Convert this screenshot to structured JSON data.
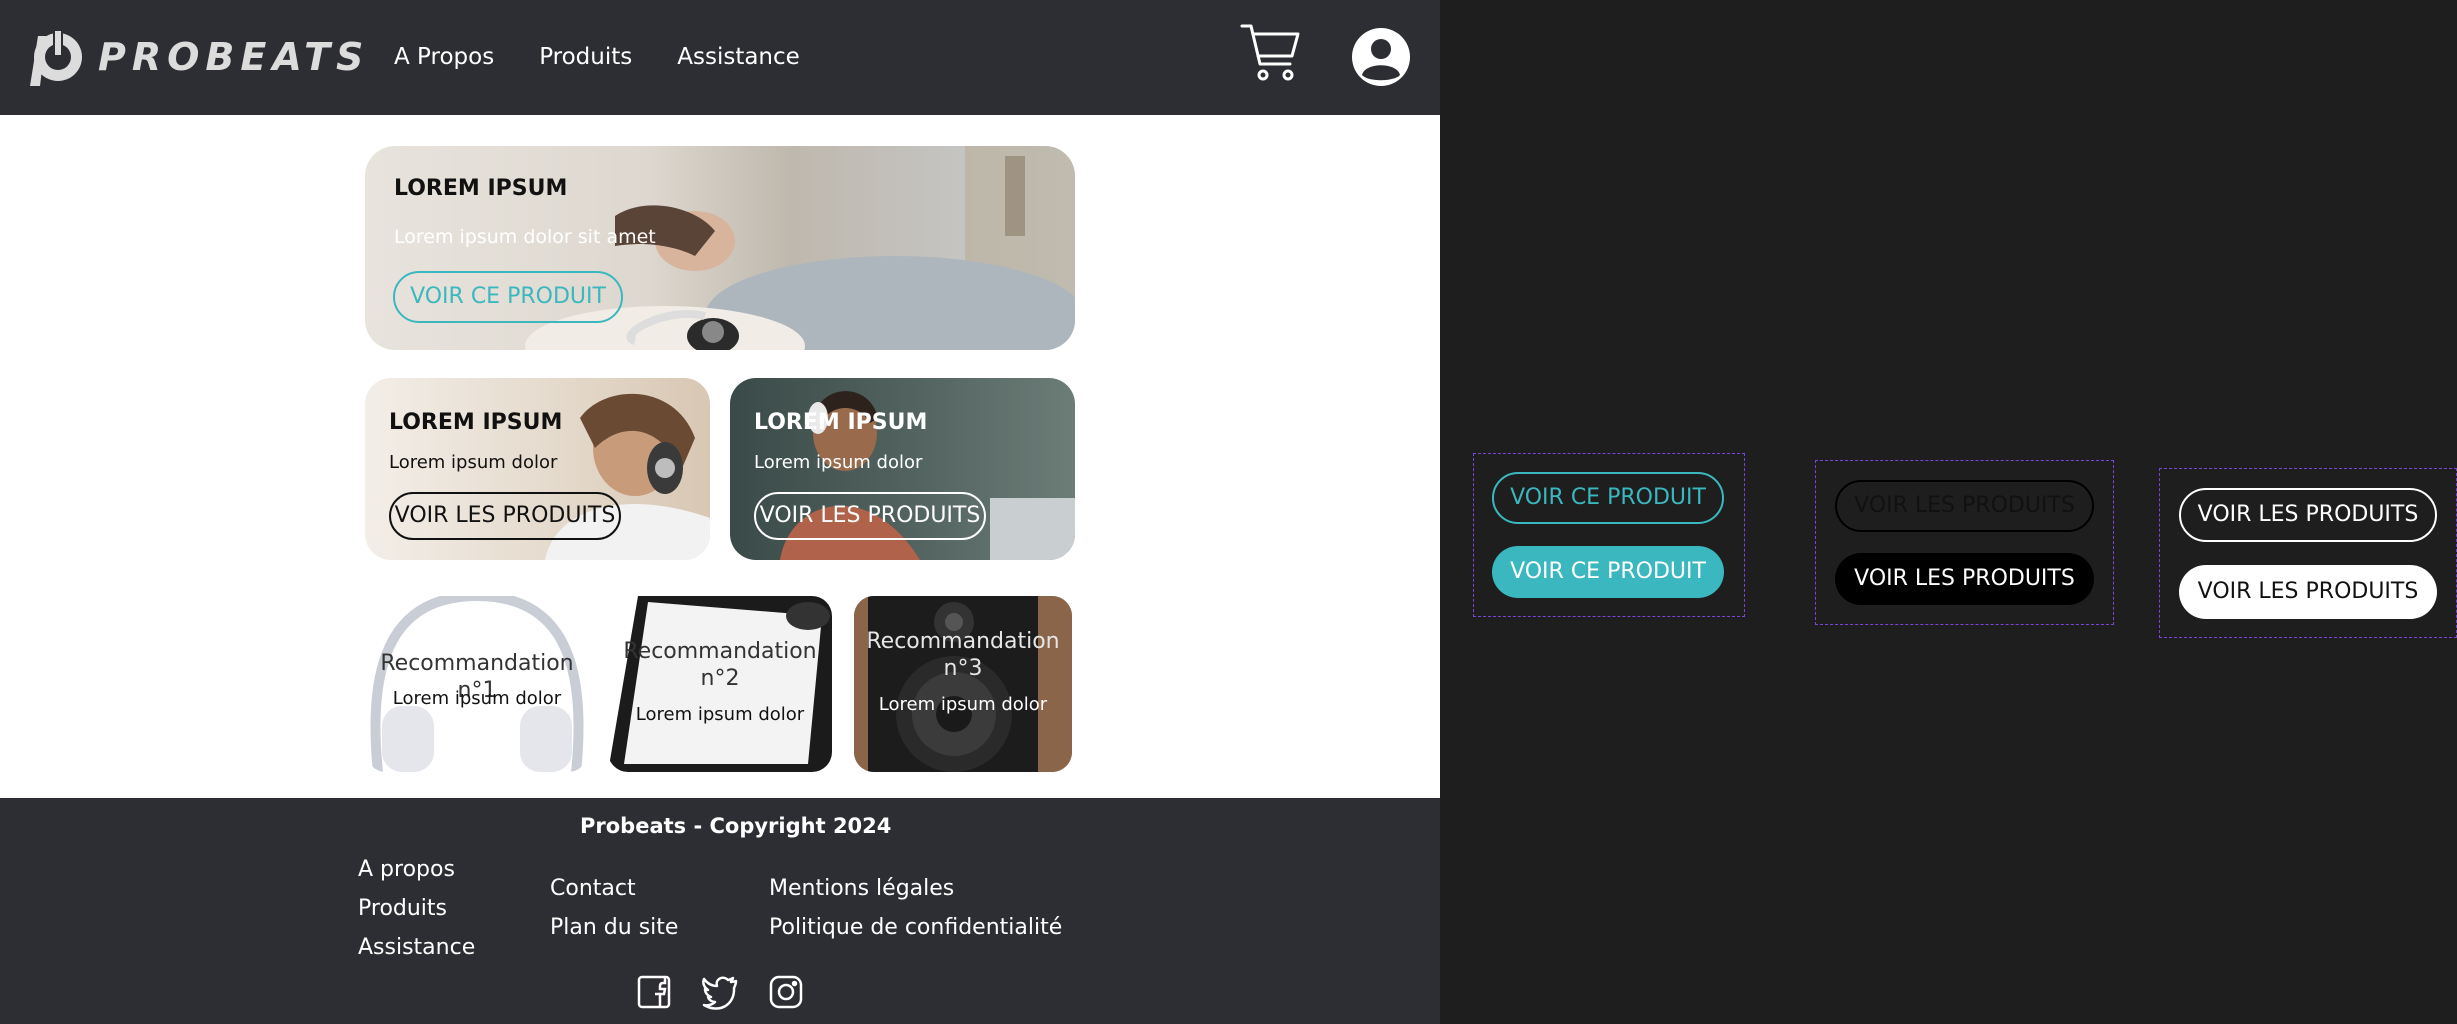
{
  "header": {
    "brand": "PROBEATS",
    "nav": [
      "A Propos",
      "Produits",
      "Assistance"
    ]
  },
  "hero": {
    "title": "LOREM IPSUM",
    "subtitle": "Lorem ipsum dolor sit amet",
    "button": "VOIR CE PRODUIT"
  },
  "cards": [
    {
      "title": "LOREM IPSUM",
      "subtitle": "Lorem ipsum dolor",
      "button": "VOIR LES PRODUITS"
    },
    {
      "title": "LOREM IPSUM",
      "subtitle": "Lorem ipsum dolor",
      "button": "VOIR LES PRODUITS"
    }
  ],
  "recommendations": [
    {
      "title": "Recommandation n°1",
      "subtitle": "Lorem ipsum dolor"
    },
    {
      "title": "Recommandation n°2",
      "subtitle": "Lorem ipsum dolor"
    },
    {
      "title": "Recommandation n°3",
      "subtitle": "Lorem ipsum dolor"
    }
  ],
  "footer": {
    "copyright": "Probeats - Copyright 2024",
    "col1": [
      "A propos",
      "Produits",
      "Assistance"
    ],
    "col2": [
      "Contact",
      "Plan du site"
    ],
    "col3": [
      "Mentions légales",
      "Politique de confidentialité"
    ],
    "social": [
      "facebook-icon",
      "twitter-icon",
      "instagram-icon"
    ]
  },
  "components": {
    "teal_outline": "VOIR CE PRODUIT",
    "teal_filled": "VOIR CE PRODUIT",
    "dark_outline": "VOIR LES PRODUITS",
    "dark_filled": "VOIR LES PRODUITS",
    "light_outline": "VOIR LES PRODUITS",
    "light_filled": "VOIR LES PRODUITS"
  },
  "colors": {
    "accent": "#3bb8bf",
    "header_bg": "#2d2e33",
    "canvas_bg": "#1e1e1e",
    "frame_outline": "#7b45d9"
  }
}
